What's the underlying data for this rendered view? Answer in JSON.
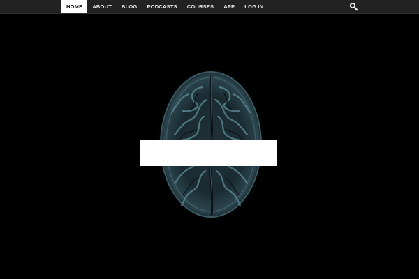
{
  "nav": {
    "items": [
      {
        "label": "HOME",
        "active": true
      },
      {
        "label": "ABOUT",
        "active": false
      },
      {
        "label": "BLOG",
        "active": false
      },
      {
        "label": "PODCASTS",
        "active": false
      },
      {
        "label": "COURSES",
        "active": false
      },
      {
        "label": "APP",
        "active": false
      },
      {
        "label": "LOG IN",
        "active": false
      }
    ],
    "search_icon": "search-icon"
  },
  "colors": {
    "topbar": "#222222",
    "active_tab_bg": "#ffffff",
    "page_bg": "#000000",
    "brain_tint": "#3d5a63"
  },
  "hero": {
    "image": "brain-mri-axial",
    "overlay": "white-box"
  }
}
